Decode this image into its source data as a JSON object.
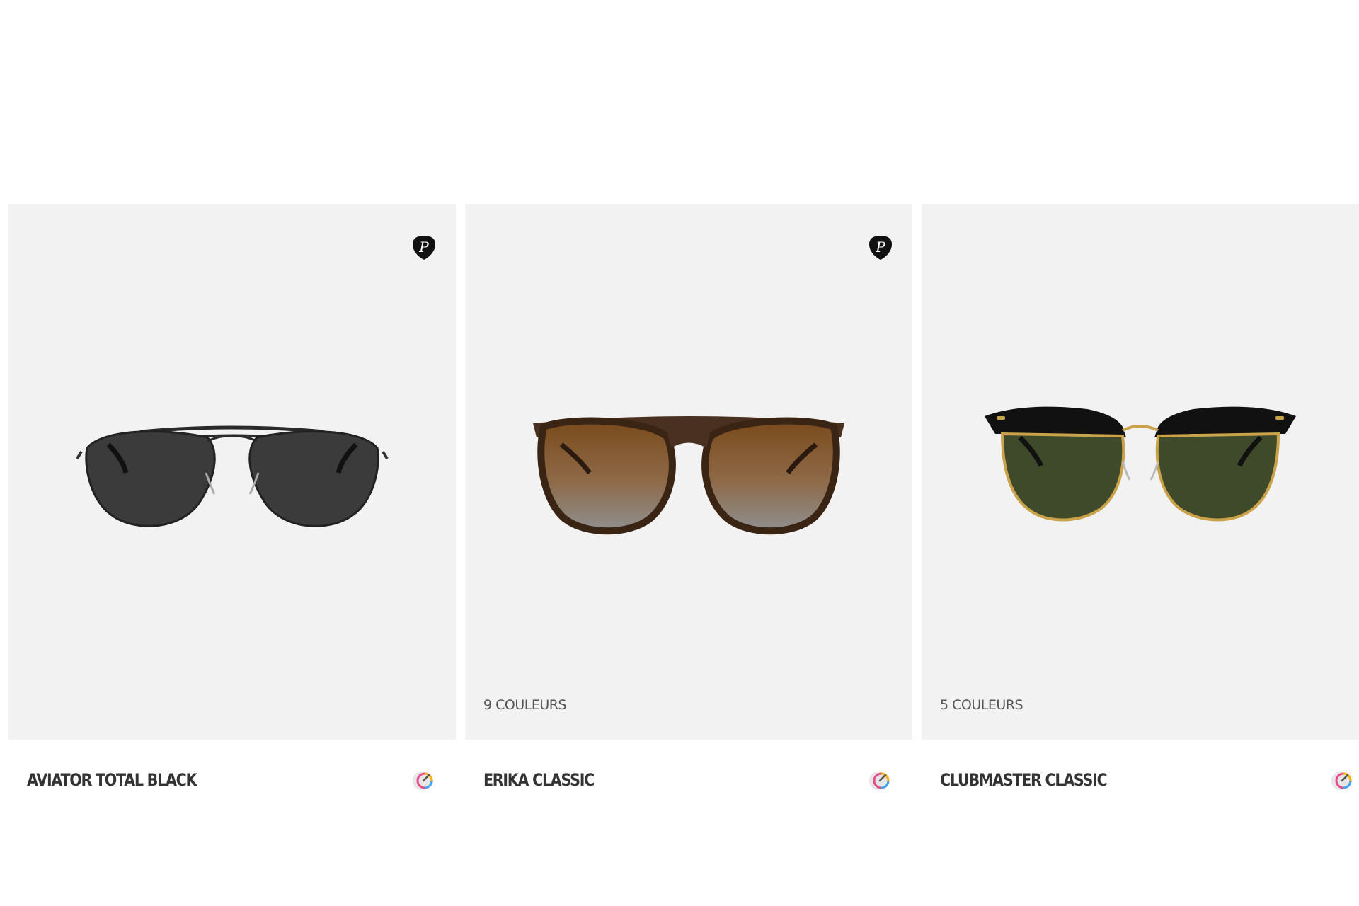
{
  "products": [
    {
      "name": "AVIATOR TOTAL BLACK",
      "colors_label": "",
      "polarized_badge": "polarized-icon",
      "image": "aviator-sunglasses-icon",
      "tryon_icon": "virtual-try-on-icon",
      "lens_color": "#3b3b3b",
      "frame_color": "#2a2a2a"
    },
    {
      "name": "ERIKA CLASSIC",
      "colors_label": "9 COULEURS",
      "polarized_badge": "polarized-icon",
      "image": "round-sunglasses-icon",
      "tryon_icon": "virtual-try-on-icon",
      "lens_color": "#8a5a2a",
      "frame_color": "#4a3020"
    },
    {
      "name": "CLUBMASTER CLASSIC",
      "colors_label": "5 COULEURS",
      "polarized_badge": "",
      "image": "clubmaster-sunglasses-icon",
      "tryon_icon": "virtual-try-on-icon",
      "lens_color": "#3f4a2a",
      "frame_color": "#111111"
    }
  ]
}
